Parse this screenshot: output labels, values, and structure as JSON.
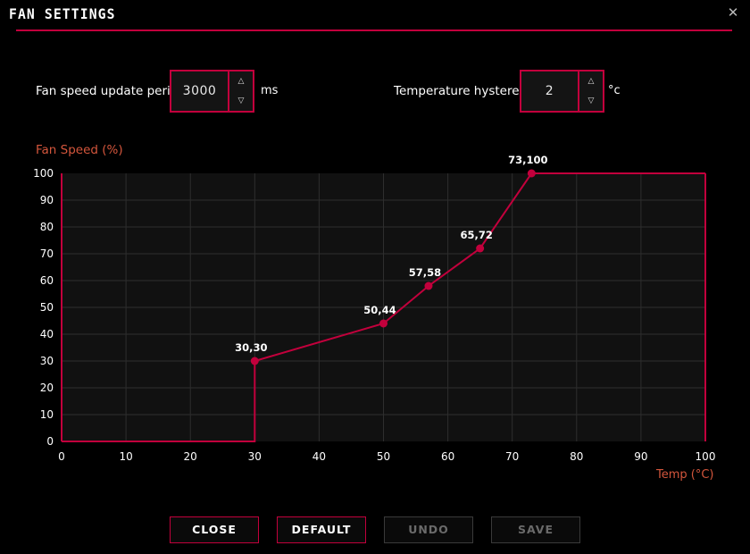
{
  "window": {
    "title": "FAN SETTINGS",
    "close_icon": "close-icon",
    "close_glyph": "✕",
    "accent_color": "#c2003c",
    "axis_label_color": "#d4563c",
    "background_color": "#000000"
  },
  "settings": {
    "update_period": {
      "label": "Fan speed update period:",
      "value": "3000",
      "unit": "ms",
      "up_glyph": "△",
      "down_glyph": "▽"
    },
    "hysteresis": {
      "label": "Temperature hysteresis:",
      "value": "2",
      "unit": "°c",
      "up_glyph": "△",
      "down_glyph": "▽"
    }
  },
  "chart_data": {
    "type": "line",
    "title": "",
    "xlabel": "Temp (°C)",
    "ylabel": "Fan Speed (%)",
    "xlim": [
      0,
      100
    ],
    "ylim": [
      0,
      100
    ],
    "xticks": [
      0,
      10,
      20,
      30,
      40,
      50,
      60,
      70,
      80,
      90,
      100
    ],
    "yticks": [
      0,
      10,
      20,
      30,
      40,
      50,
      60,
      70,
      80,
      90,
      100
    ],
    "grid": true,
    "legend": "none",
    "line_color": "#c2003c",
    "marker_color": "#c2003c",
    "points": [
      {
        "x": 30,
        "y": 30,
        "label": "30,30"
      },
      {
        "x": 50,
        "y": 44,
        "label": "50,44"
      },
      {
        "x": 57,
        "y": 58,
        "label": "57,58"
      },
      {
        "x": 65,
        "y": 72,
        "label": "65,72"
      },
      {
        "x": 73,
        "y": 100,
        "label": "73,100"
      }
    ],
    "curve": [
      {
        "x": 0,
        "y": 0
      },
      {
        "x": 30,
        "y": 0
      },
      {
        "x": 30,
        "y": 30
      },
      {
        "x": 50,
        "y": 44
      },
      {
        "x": 57,
        "y": 58
      },
      {
        "x": 65,
        "y": 72
      },
      {
        "x": 73,
        "y": 100
      },
      {
        "x": 100,
        "y": 100
      }
    ]
  },
  "buttons": [
    {
      "label": "CLOSE",
      "name": "close-button",
      "enabled": true
    },
    {
      "label": "DEFAULT",
      "name": "default-button",
      "enabled": true
    },
    {
      "label": "UNDO",
      "name": "undo-button",
      "enabled": false
    },
    {
      "label": "SAVE",
      "name": "save-button",
      "enabled": false
    }
  ]
}
